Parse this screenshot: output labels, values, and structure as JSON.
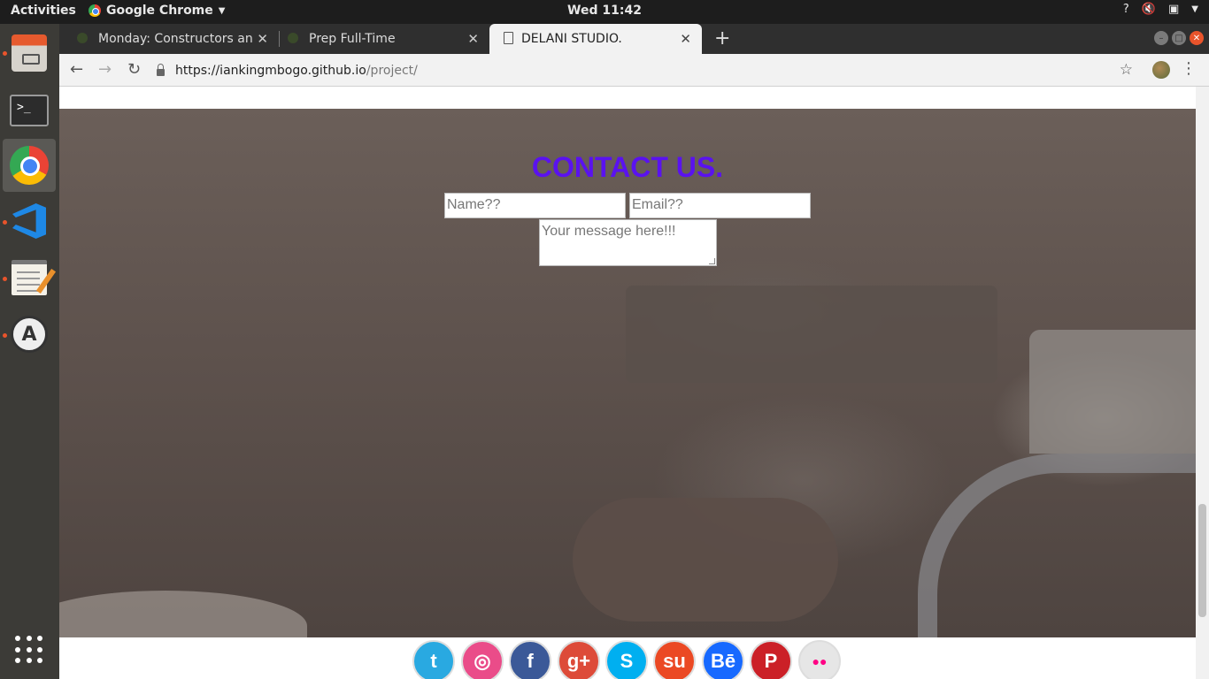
{
  "topbar": {
    "activities": "Activities",
    "app_name": "Google Chrome",
    "clock": "Wed 11:42",
    "help": "?"
  },
  "dock": {
    "items": [
      {
        "name": "Files",
        "icon": "files-icon"
      },
      {
        "name": "Terminal",
        "icon": "terminal-icon",
        "glyph": ">_"
      },
      {
        "name": "Google Chrome",
        "icon": "chrome-icon"
      },
      {
        "name": "Visual Studio Code",
        "icon": "vscode-icon"
      },
      {
        "name": "Text Editor",
        "icon": "text-editor-icon"
      },
      {
        "name": "Software Updater",
        "icon": "software-updater-icon",
        "glyph": "A"
      }
    ]
  },
  "browser": {
    "tabs": [
      {
        "title": "Monday: Constructors an"
      },
      {
        "title": "Prep Full-Time"
      },
      {
        "title": "DELANI STUDIO.",
        "active": true
      }
    ],
    "url_host": "https://iankingmbogo.github.io",
    "url_path": "/project/"
  },
  "page": {
    "contact_title": "CONTACT US.",
    "name_placeholder": "Name??",
    "email_placeholder": "Email??",
    "message_placeholder": "Your message here!!!",
    "social": [
      {
        "name": "twitter",
        "glyph": "t",
        "color": "#29a9e1"
      },
      {
        "name": "dribbble",
        "glyph": "◎",
        "color": "#ea4c89"
      },
      {
        "name": "facebook",
        "glyph": "f",
        "color": "#3b5998"
      },
      {
        "name": "google-plus",
        "glyph": "g+",
        "color": "#dd4b39"
      },
      {
        "name": "skype",
        "glyph": "S",
        "color": "#00aff0"
      },
      {
        "name": "stumbleupon",
        "glyph": "su",
        "color": "#eb4924"
      },
      {
        "name": "behance",
        "glyph": "Bē",
        "color": "#1769ff"
      },
      {
        "name": "pinterest",
        "glyph": "P",
        "color": "#cb2027"
      },
      {
        "name": "flickr",
        "glyph": "●●",
        "color": "#e6e6e6"
      }
    ]
  }
}
